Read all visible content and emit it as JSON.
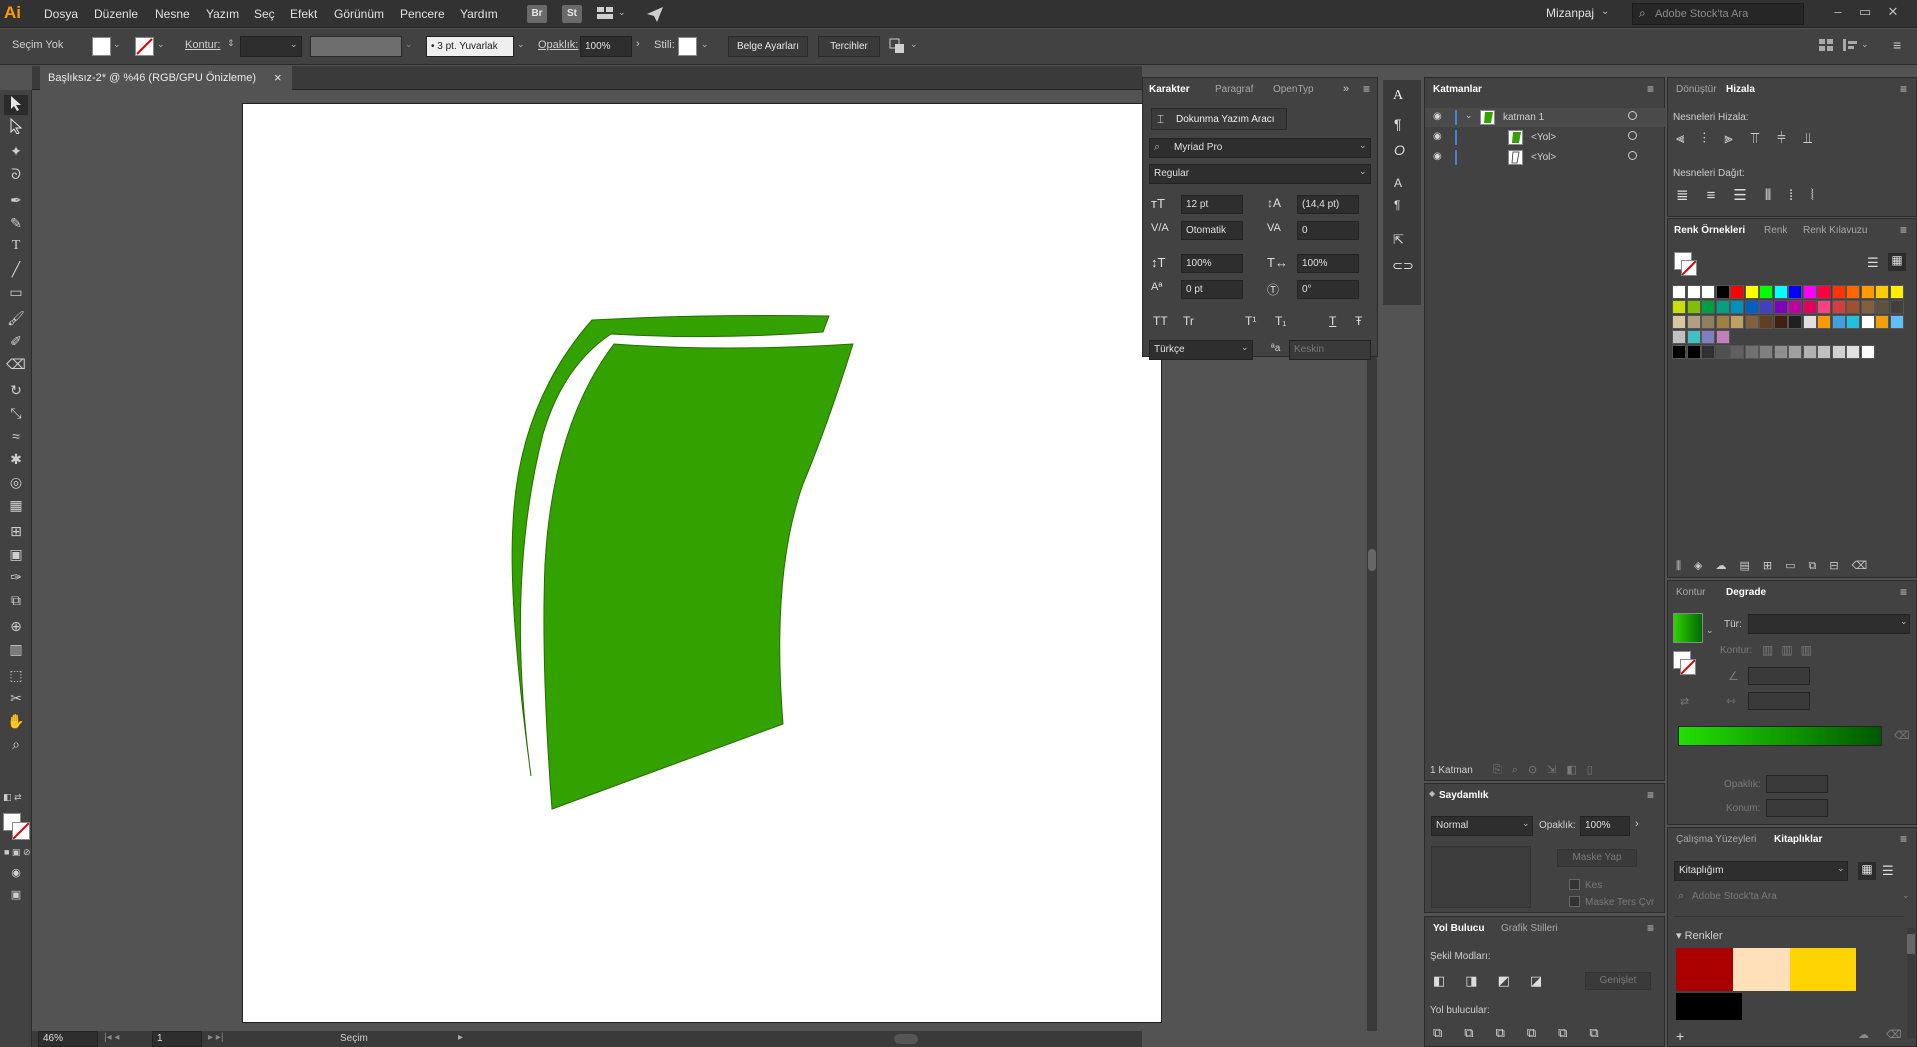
{
  "app": {
    "logo": "Ai"
  },
  "menu": [
    "Dosya",
    "Düzenle",
    "Nesne",
    "Yazım",
    "Seç",
    "Efekt",
    "Görünüm",
    "Pencere",
    "Yardım"
  ],
  "badges": [
    "Br",
    "St"
  ],
  "workspace": "Mizanpaj",
  "search": {
    "placeholder": "Adobe Stock'ta Ara"
  },
  "control": {
    "selection": "Seçim Yok",
    "stroke_label": "Kontur:",
    "brush": "3 pt. Yuvarlak",
    "opacity_label": "Opaklık:",
    "opacity": "100%",
    "style_label": "Stili:",
    "doc_setup": "Belge Ayarları",
    "prefs": "Tercihler"
  },
  "document": {
    "tab": "Başlıksız-2* @ %46 (RGB/GPU Önizleme)",
    "close": "×"
  },
  "status": {
    "zoom": "46%",
    "page": "1",
    "mode": "Seçim"
  },
  "character": {
    "tabs": [
      "Karakter",
      "Paragraf",
      "OpenTyp"
    ],
    "touch_tool": "Dokunma Yazım Aracı",
    "font": "Myriad Pro",
    "style": "Regular",
    "size": "12 pt",
    "leading": "(14,4 pt)",
    "kerning": "Otomatik",
    "tracking": "0",
    "vscale": "100%",
    "hscale": "100%",
    "baseline": "0 pt",
    "rotation": "0°",
    "type_buttons": [
      "TT",
      "Tr",
      "T¹",
      "T₁",
      "T",
      "Ŧ"
    ],
    "language": "Türkçe",
    "aa_label": "ªa",
    "aa": "Keskin"
  },
  "layers": {
    "title": "Katmanlar",
    "rows": [
      {
        "name": "katman 1"
      },
      {
        "name": "<Yol>"
      },
      {
        "name": "<Yol>"
      }
    ],
    "count": "1 Katman"
  },
  "transparency": {
    "title": "Saydamlık",
    "mode": "Normal",
    "opacity_label": "Opaklık:",
    "opacity": "100%",
    "mask": "Maske Yap",
    "clip": "Kes",
    "invert": "Maske Ters Çvr"
  },
  "pathfinder": {
    "tabs": [
      "Yol Bulucu",
      "Grafik Stilleri"
    ],
    "shape_modes": "Şekil Modları:",
    "expand": "Genişlet",
    "pathfinders": "Yol bulucular:"
  },
  "align": {
    "tabs": [
      "Dönüştür",
      "Hizala"
    ],
    "align_objects": "Nesneleri Hizala:",
    "distribute": "Nesneleri Dağıt:"
  },
  "swatches": {
    "tabs": [
      "Renk Örnekleri",
      "Renk",
      "Renk Kılavuzu"
    ]
  },
  "gradient": {
    "tabs": [
      "Kontur",
      "Degrade"
    ],
    "type_label": "Tür:",
    "stroke_label": "Kontur:",
    "opacity_label": "Opaklık:",
    "location_label": "Konum:"
  },
  "libraries": {
    "tabs": [
      "Çalışma Yüzeyleri",
      "Kitaplıklar"
    ],
    "library": "Kitaplığım",
    "search": "Adobe Stock'ta Ara",
    "section": "Renkler"
  },
  "colors": {
    "accent_green": "#33a100",
    "lib": [
      "#aa0000",
      "#ffe0b8",
      "#ffd400",
      "#000000"
    ]
  }
}
